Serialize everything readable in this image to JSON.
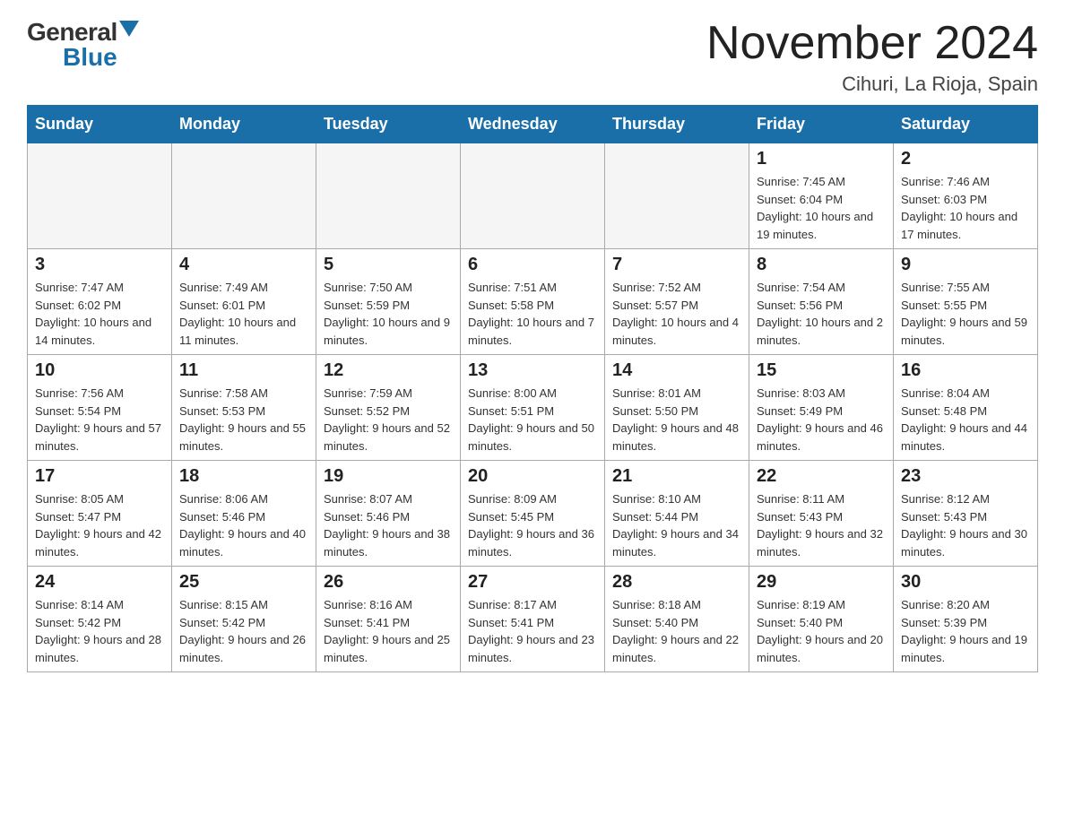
{
  "header": {
    "logo_general": "General",
    "logo_blue": "Blue",
    "title": "November 2024",
    "subtitle": "Cihuri, La Rioja, Spain"
  },
  "days_of_week": [
    "Sunday",
    "Monday",
    "Tuesday",
    "Wednesday",
    "Thursday",
    "Friday",
    "Saturday"
  ],
  "weeks": [
    [
      {
        "day": "",
        "info": ""
      },
      {
        "day": "",
        "info": ""
      },
      {
        "day": "",
        "info": ""
      },
      {
        "day": "",
        "info": ""
      },
      {
        "day": "",
        "info": ""
      },
      {
        "day": "1",
        "info": "Sunrise: 7:45 AM\nSunset: 6:04 PM\nDaylight: 10 hours and 19 minutes."
      },
      {
        "day": "2",
        "info": "Sunrise: 7:46 AM\nSunset: 6:03 PM\nDaylight: 10 hours and 17 minutes."
      }
    ],
    [
      {
        "day": "3",
        "info": "Sunrise: 7:47 AM\nSunset: 6:02 PM\nDaylight: 10 hours and 14 minutes."
      },
      {
        "day": "4",
        "info": "Sunrise: 7:49 AM\nSunset: 6:01 PM\nDaylight: 10 hours and 11 minutes."
      },
      {
        "day": "5",
        "info": "Sunrise: 7:50 AM\nSunset: 5:59 PM\nDaylight: 10 hours and 9 minutes."
      },
      {
        "day": "6",
        "info": "Sunrise: 7:51 AM\nSunset: 5:58 PM\nDaylight: 10 hours and 7 minutes."
      },
      {
        "day": "7",
        "info": "Sunrise: 7:52 AM\nSunset: 5:57 PM\nDaylight: 10 hours and 4 minutes."
      },
      {
        "day": "8",
        "info": "Sunrise: 7:54 AM\nSunset: 5:56 PM\nDaylight: 10 hours and 2 minutes."
      },
      {
        "day": "9",
        "info": "Sunrise: 7:55 AM\nSunset: 5:55 PM\nDaylight: 9 hours and 59 minutes."
      }
    ],
    [
      {
        "day": "10",
        "info": "Sunrise: 7:56 AM\nSunset: 5:54 PM\nDaylight: 9 hours and 57 minutes."
      },
      {
        "day": "11",
        "info": "Sunrise: 7:58 AM\nSunset: 5:53 PM\nDaylight: 9 hours and 55 minutes."
      },
      {
        "day": "12",
        "info": "Sunrise: 7:59 AM\nSunset: 5:52 PM\nDaylight: 9 hours and 52 minutes."
      },
      {
        "day": "13",
        "info": "Sunrise: 8:00 AM\nSunset: 5:51 PM\nDaylight: 9 hours and 50 minutes."
      },
      {
        "day": "14",
        "info": "Sunrise: 8:01 AM\nSunset: 5:50 PM\nDaylight: 9 hours and 48 minutes."
      },
      {
        "day": "15",
        "info": "Sunrise: 8:03 AM\nSunset: 5:49 PM\nDaylight: 9 hours and 46 minutes."
      },
      {
        "day": "16",
        "info": "Sunrise: 8:04 AM\nSunset: 5:48 PM\nDaylight: 9 hours and 44 minutes."
      }
    ],
    [
      {
        "day": "17",
        "info": "Sunrise: 8:05 AM\nSunset: 5:47 PM\nDaylight: 9 hours and 42 minutes."
      },
      {
        "day": "18",
        "info": "Sunrise: 8:06 AM\nSunset: 5:46 PM\nDaylight: 9 hours and 40 minutes."
      },
      {
        "day": "19",
        "info": "Sunrise: 8:07 AM\nSunset: 5:46 PM\nDaylight: 9 hours and 38 minutes."
      },
      {
        "day": "20",
        "info": "Sunrise: 8:09 AM\nSunset: 5:45 PM\nDaylight: 9 hours and 36 minutes."
      },
      {
        "day": "21",
        "info": "Sunrise: 8:10 AM\nSunset: 5:44 PM\nDaylight: 9 hours and 34 minutes."
      },
      {
        "day": "22",
        "info": "Sunrise: 8:11 AM\nSunset: 5:43 PM\nDaylight: 9 hours and 32 minutes."
      },
      {
        "day": "23",
        "info": "Sunrise: 8:12 AM\nSunset: 5:43 PM\nDaylight: 9 hours and 30 minutes."
      }
    ],
    [
      {
        "day": "24",
        "info": "Sunrise: 8:14 AM\nSunset: 5:42 PM\nDaylight: 9 hours and 28 minutes."
      },
      {
        "day": "25",
        "info": "Sunrise: 8:15 AM\nSunset: 5:42 PM\nDaylight: 9 hours and 26 minutes."
      },
      {
        "day": "26",
        "info": "Sunrise: 8:16 AM\nSunset: 5:41 PM\nDaylight: 9 hours and 25 minutes."
      },
      {
        "day": "27",
        "info": "Sunrise: 8:17 AM\nSunset: 5:41 PM\nDaylight: 9 hours and 23 minutes."
      },
      {
        "day": "28",
        "info": "Sunrise: 8:18 AM\nSunset: 5:40 PM\nDaylight: 9 hours and 22 minutes."
      },
      {
        "day": "29",
        "info": "Sunrise: 8:19 AM\nSunset: 5:40 PM\nDaylight: 9 hours and 20 minutes."
      },
      {
        "day": "30",
        "info": "Sunrise: 8:20 AM\nSunset: 5:39 PM\nDaylight: 9 hours and 19 minutes."
      }
    ]
  ]
}
